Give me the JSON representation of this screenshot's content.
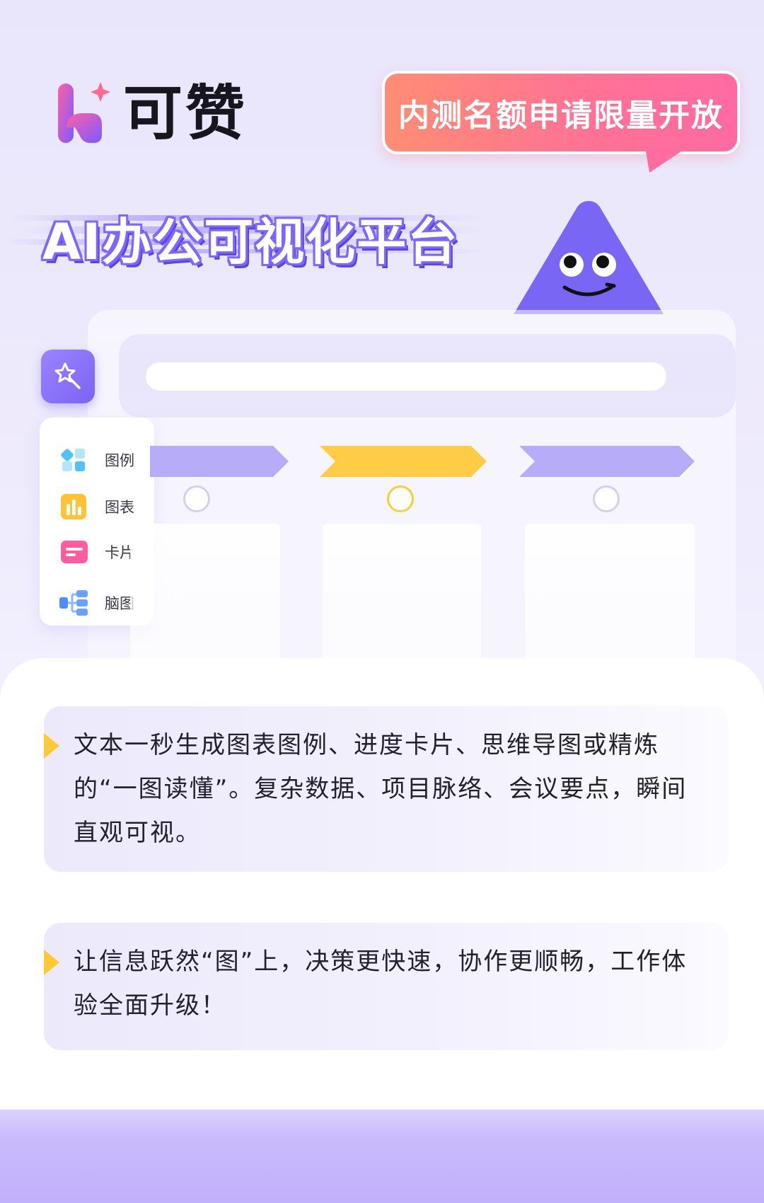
{
  "brand": {
    "name": "可赞",
    "colors": {
      "primary": "#7c63f4",
      "accent_yellow": "#ffcc33",
      "bubble_start": "#ff8d73",
      "bubble_end": "#ff6aa3"
    }
  },
  "promo": {
    "bubble": "内测名额申请限量开放"
  },
  "headline": "AI办公可视化平台",
  "menu": {
    "items": [
      {
        "label": "图例",
        "icon": "legend-grid-icon"
      },
      {
        "label": "图表",
        "icon": "bar-chart-icon"
      },
      {
        "label": "卡片",
        "icon": "card-icon"
      },
      {
        "label": "脑图",
        "icon": "mind-map-icon"
      }
    ]
  },
  "steps": [
    {
      "state": "inactive"
    },
    {
      "state": "active"
    },
    {
      "state": "inactive"
    }
  ],
  "tips": [
    "文本一秒生成图表图例、进度卡片、思维导图或精炼的“一图读懂”。复杂数据、项目脉络、会议要点，瞬间直观可视。",
    "让信息跃然“图”上，决策更快速，协作更顺畅，工作体验全面升级！"
  ]
}
